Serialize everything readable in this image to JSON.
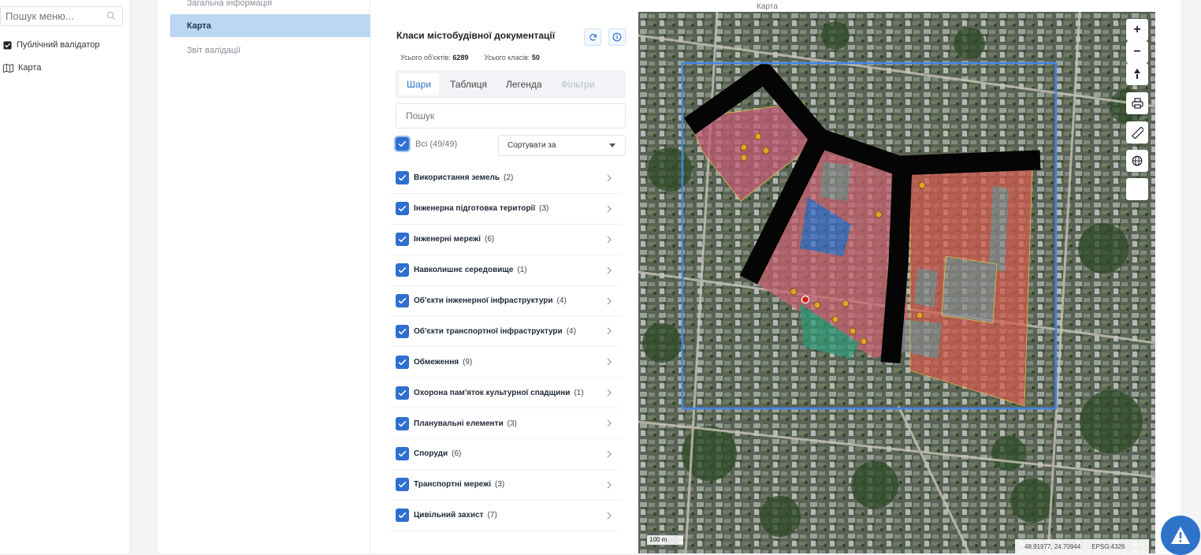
{
  "sidebar": {
    "search_placeholder": "Пошук меню...",
    "items": [
      {
        "label": "Публічний валідатор",
        "icon": "checkbox-icon"
      },
      {
        "label": "Карта",
        "icon": "map-icon"
      }
    ]
  },
  "subnav": {
    "items": [
      {
        "label": "Загальна інформація",
        "active": false
      },
      {
        "label": "Карта",
        "active": true
      },
      {
        "label": "Звіт валідації",
        "active": false
      }
    ]
  },
  "map_caption": "Карта",
  "layers_panel": {
    "title": "Класи містобудівної документації",
    "total_objects_label": "Усього об'єктів:",
    "total_objects": "6289",
    "total_classes_label": "Усього класів:",
    "total_classes": "50",
    "tabs": [
      {
        "label": "Шари",
        "state": "active"
      },
      {
        "label": "Таблиця",
        "state": "normal"
      },
      {
        "label": "Легенда",
        "state": "normal"
      },
      {
        "label": "Фільтри",
        "state": "disabled"
      }
    ],
    "search_placeholder": "Пошук",
    "all_label": "Всі (49/49)",
    "sort_label": "Сортувати за",
    "layers": [
      {
        "name": "Використання земель",
        "count": "(2)"
      },
      {
        "name": "Інженерна підготовка території",
        "count": "(3)"
      },
      {
        "name": "Інженерні мережі",
        "count": "(6)"
      },
      {
        "name": "Навколишнє середовище",
        "count": "(1)"
      },
      {
        "name": "Об'єкти інженерної інфраструктури",
        "count": "(4)"
      },
      {
        "name": "Об'єкти транспортної інфраструктури",
        "count": "(4)"
      },
      {
        "name": "Обмеження",
        "count": "(9)"
      },
      {
        "name": "Охорона пам'яток культурної спадщини",
        "count": "(1)"
      },
      {
        "name": "Планувальні елементи",
        "count": "(3)"
      },
      {
        "name": "Споруди",
        "count": "(6)"
      },
      {
        "name": "Транспортні мережі",
        "count": "(3)"
      },
      {
        "name": "Цивільний захист",
        "count": "(7)"
      }
    ]
  },
  "map": {
    "scale_label": "100 m",
    "coordinates": "48.91977, 24.70944",
    "projection": "EPSG:4326",
    "controls": [
      "zoom-in-icon",
      "zoom-out-icon",
      "north-arrow-icon",
      "print-icon",
      "ruler-icon",
      "globe-icon",
      "blank"
    ],
    "accent": "#2f73c9"
  }
}
